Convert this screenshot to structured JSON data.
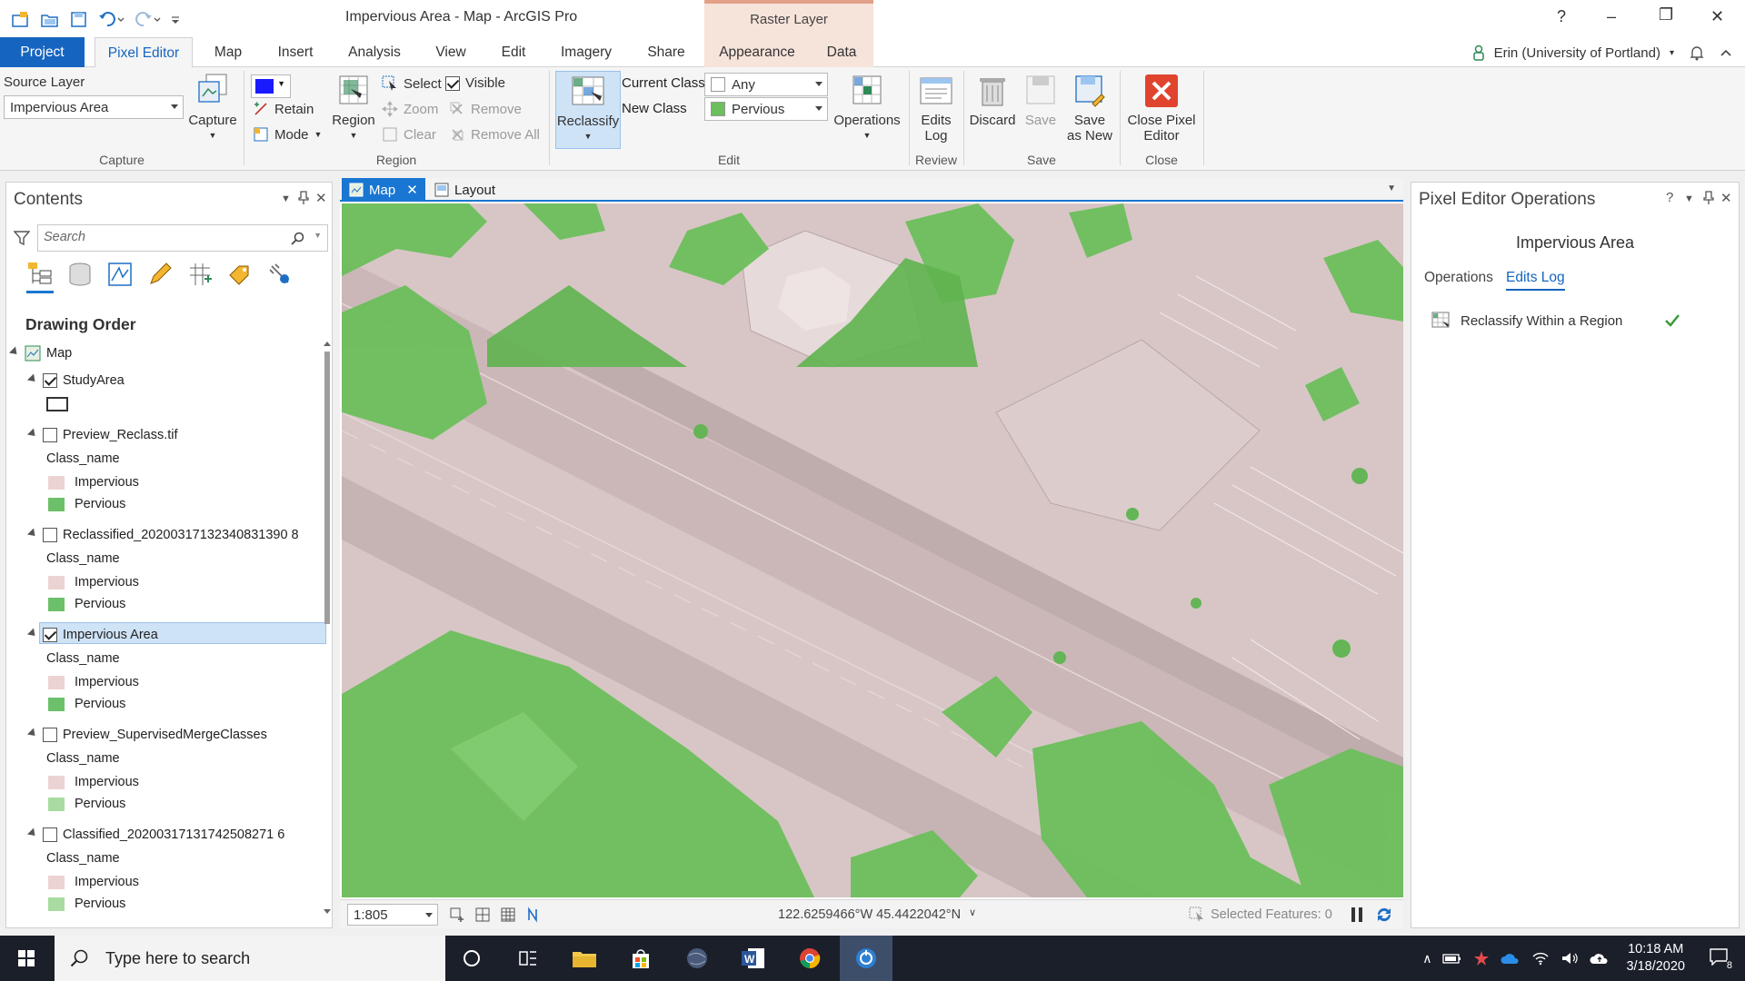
{
  "window": {
    "title": "Impervious Area - Map - ArcGIS Pro",
    "contextual_tab_group": "Raster Layer"
  },
  "tabs": [
    "Project",
    "Pixel Editor",
    "Map",
    "Insert",
    "Analysis",
    "View",
    "Edit",
    "Imagery",
    "Share",
    "Appearance",
    "Data"
  ],
  "user": {
    "name": "Erin (University of Portland)"
  },
  "ribbon": {
    "capture": {
      "group_label": "Capture",
      "source_layer_label": "Source Layer",
      "source_layer_value": "Impervious Area",
      "capture_btn": "Capture"
    },
    "region": {
      "group_label": "Region",
      "retain": "Retain",
      "mode": "Mode",
      "region_btn": "Region",
      "select": "Select",
      "visible": "Visible",
      "zoom": "Zoom",
      "remove": "Remove",
      "clear": "Clear",
      "remove_all": "Remove All",
      "color": "#1a1aff"
    },
    "edit": {
      "group_label": "Edit",
      "reclassify": "Reclassify",
      "current_class_label": "Current Class",
      "current_class_value": "Any",
      "new_class_label": "New Class",
      "new_class_value": "Pervious",
      "new_class_color": "#6cbf5c",
      "operations": "Operations"
    },
    "review": {
      "group_label": "Review",
      "edits_log_line1": "Edits",
      "edits_log_line2": "Log"
    },
    "save": {
      "group_label": "Save",
      "discard": "Discard",
      "save": "Save",
      "save_as_new_line1": "Save",
      "save_as_new_line2": "as New"
    },
    "close": {
      "group_label": "Close",
      "close_line1": "Close Pixel",
      "close_line2": "Editor"
    }
  },
  "contents": {
    "title": "Contents",
    "search_placeholder": "Search",
    "drawing_order": "Drawing Order",
    "impervious_color": "#ecd3d3",
    "pervious_color": "#6cc06a",
    "layers": {
      "map": "Map",
      "study_area": "StudyArea",
      "preview_reclass": "Preview_Reclass.tif",
      "reclassified": "Reclassified_20200317132340831390 8",
      "impervious_area": "Impervious Area",
      "preview_supervised": "Preview_SupervisedMergeClasses",
      "classified": "Classified_20200317131742508271 6"
    },
    "class_name": "Class_name",
    "impervious": "Impervious",
    "pervious": "Pervious"
  },
  "mapview": {
    "tab_map": "Map",
    "tab_layout": "Layout",
    "scale": "1:805",
    "coordinates": "122.6259466°W 45.4422042°N",
    "selected_features": "Selected Features: 0"
  },
  "pixel_ops": {
    "title": "Pixel Editor Operations",
    "subtitle": "Impervious Area",
    "tab_operations": "Operations",
    "tab_edits_log": "Edits Log",
    "log_item": "Reclassify Within a Region"
  },
  "taskbar": {
    "search_placeholder": "Type here to search",
    "time": "10:18 AM",
    "date": "3/18/2020",
    "notifications": "8"
  }
}
